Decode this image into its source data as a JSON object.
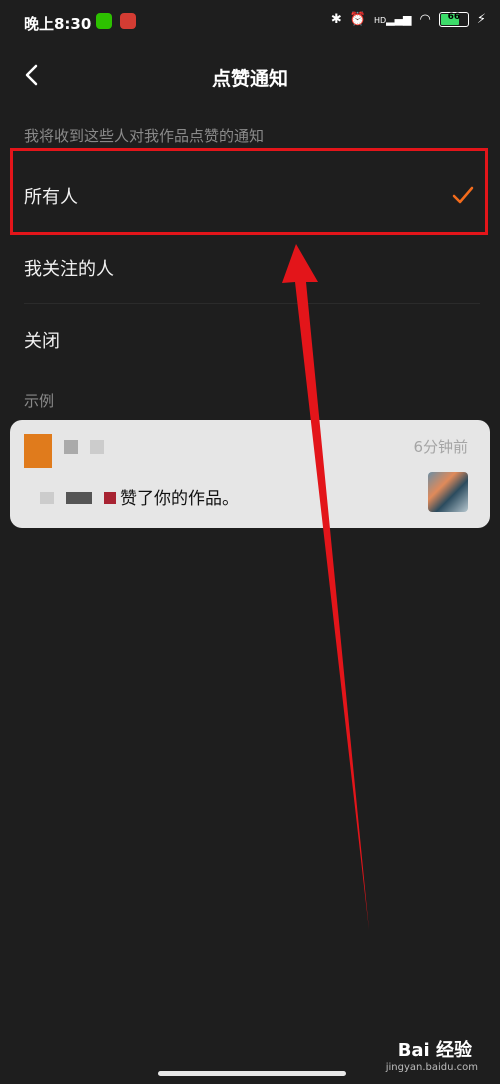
{
  "status_bar": {
    "time": "晚上8:30",
    "hd_label": "HD",
    "battery_level": "66",
    "wechat_color": "#2dc100",
    "netease_color": "#d43c33"
  },
  "navbar": {
    "title": "点赞通知"
  },
  "section_title": "我将收到这些人对我作品点赞的通知",
  "options": [
    {
      "label": "所有人",
      "selected": true
    },
    {
      "label": "我关注的人",
      "selected": false
    },
    {
      "label": "关闭",
      "selected": false
    }
  ],
  "example": {
    "label": "示例",
    "time": "6分钟前",
    "message": "赞了你的作品。"
  },
  "watermark": {
    "brand": "Bai 经验",
    "url": "jingyan.baidu.com"
  },
  "colors": {
    "accent": "#f36b1c",
    "highlight": "#e3151a",
    "background": "#1e1e1e"
  }
}
